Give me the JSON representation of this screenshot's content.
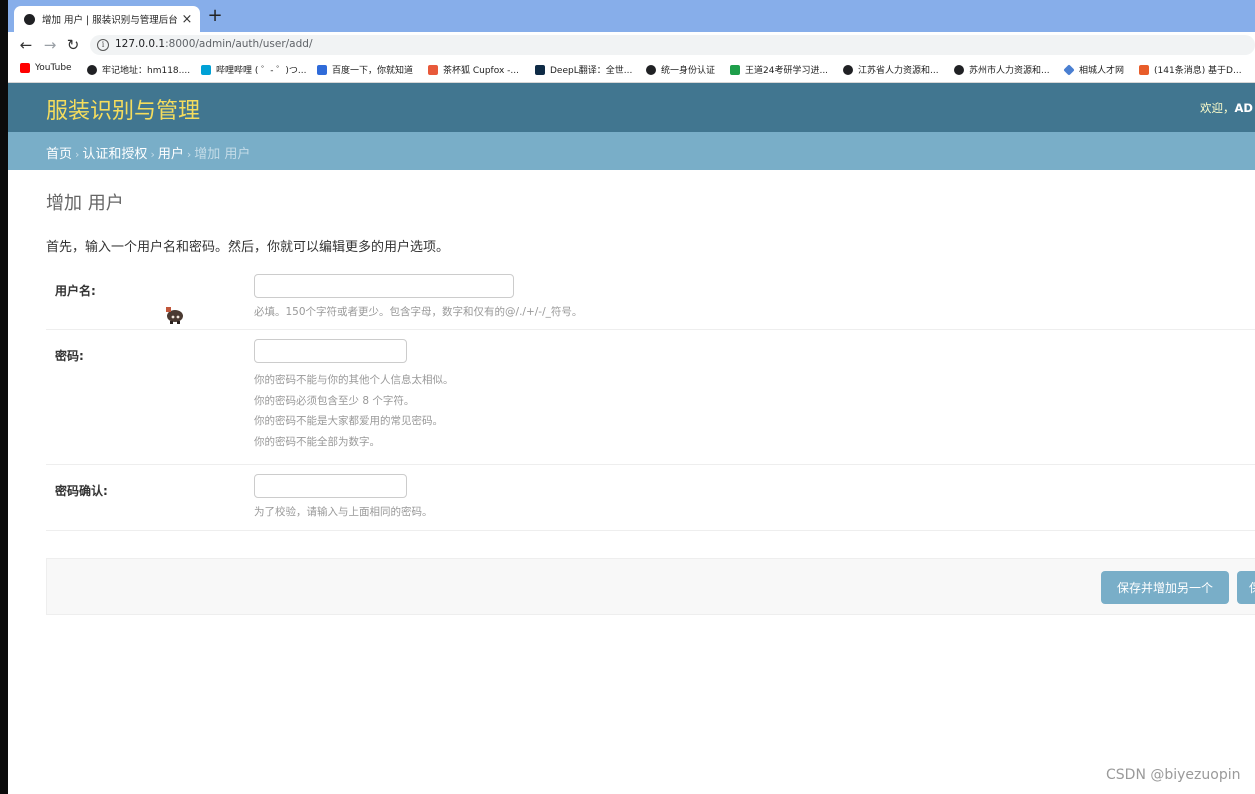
{
  "browser": {
    "tab_title": "增加 用户 | 服装识别与管理后台",
    "tab_close": "×",
    "new_tab": "+",
    "url_host": "127.0.0.1",
    "url_path": ":8000/admin/auth/user/add/",
    "nav_back": "←",
    "nav_forward": "→",
    "nav_reload": "↻",
    "bookmarks": [
      {
        "label": "YouTube",
        "color": "#ff0000"
      },
      {
        "label": "牢记地址：hm118....",
        "color": "#202124"
      },
      {
        "label": "哔哩哔哩 ( ゜- ゜)つ...",
        "color": "#00a1d6"
      },
      {
        "label": "百度一下，你就知道",
        "color": "#2f6bd9"
      },
      {
        "label": "茶杯狐 Cupfox -...",
        "color": "#e8593a"
      },
      {
        "label": "DeepL翻译：全世...",
        "color": "#0f2b46"
      },
      {
        "label": "统一身份认证",
        "color": "#202124"
      },
      {
        "label": "王道24考研学习进...",
        "color": "#1e9e4a"
      },
      {
        "label": "江苏省人力资源和...",
        "color": "#202124"
      },
      {
        "label": "苏州市人力资源和...",
        "color": "#202124"
      },
      {
        "label": "相城人才网",
        "color": "#4a7fd1"
      },
      {
        "label": "(141条消息) 基于D...",
        "color": "#e85d2a"
      }
    ]
  },
  "header": {
    "brand": "服装识别与管理",
    "welcome": "欢迎，",
    "user": "AD"
  },
  "breadcrumbs": {
    "home": "首页",
    "app": "认证和授权",
    "model": "用户",
    "current": "增加 用户",
    "separator": "›"
  },
  "content": {
    "title": "增加 用户",
    "intro": "首先，输入一个用户名和密码。然后，你就可以编辑更多的用户选项。"
  },
  "form": {
    "username": {
      "label": "用户名:",
      "value": "",
      "help": "必填。150个字符或者更少。包含字母，数字和仅有的@/./+/-/_符号。"
    },
    "password1": {
      "label": "密码:",
      "value": "",
      "help": [
        "你的密码不能与你的其他个人信息太相似。",
        "你的密码必须包含至少 8 个字符。",
        "你的密码不能是大家都爱用的常见密码。",
        "你的密码不能全部为数字。"
      ]
    },
    "password2": {
      "label": "密码确认:",
      "value": "",
      "help": "为了校验，请输入与上面相同的密码。"
    }
  },
  "buttons": {
    "save_add_another": "保存并增加另一个",
    "save_partial": "保"
  },
  "watermark": "CSDN @biyezuopin"
}
